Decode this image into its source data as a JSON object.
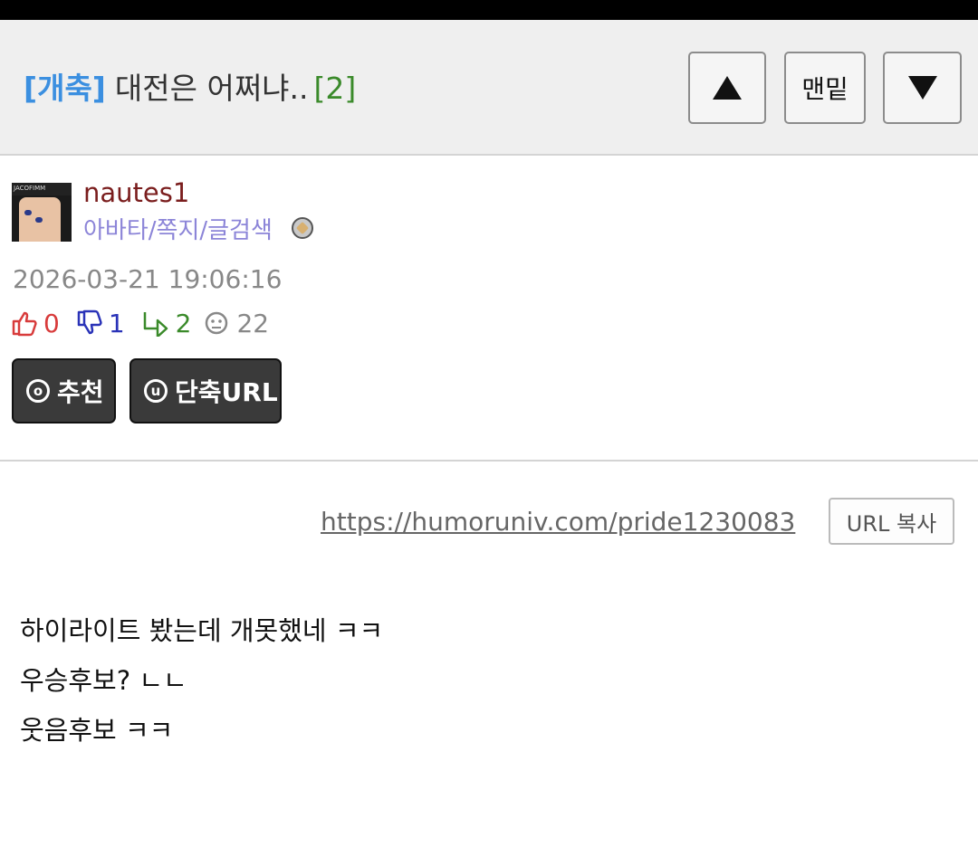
{
  "header": {
    "category": "[개축]",
    "subject": "대전은 어쩌냐..",
    "comment_count": "[2]",
    "btn_top_label": "",
    "btn_bottom_label": "맨밑"
  },
  "author": {
    "nickname": "nautes1",
    "links": "아바타/쪽지/글검색",
    "avatar_text": "JACOFIMM",
    "date": "2026-03-21 19:06:16"
  },
  "stats": {
    "recommend": "0",
    "oppose": "1",
    "replies": "2",
    "views": "22"
  },
  "actions": {
    "recommend_label": "추천",
    "recommend_icon": "o",
    "short_url_label": "단축URL",
    "short_url_icon": "u"
  },
  "url": {
    "link": "https://humoruniv.com/pride1230083",
    "copy_label": "URL 복사"
  },
  "content": {
    "lines": [
      "하이라이트 봤는데 개못했네 ㅋㅋ",
      "우승후보? ㄴㄴ",
      "웃음후보 ㅋㅋ"
    ]
  }
}
